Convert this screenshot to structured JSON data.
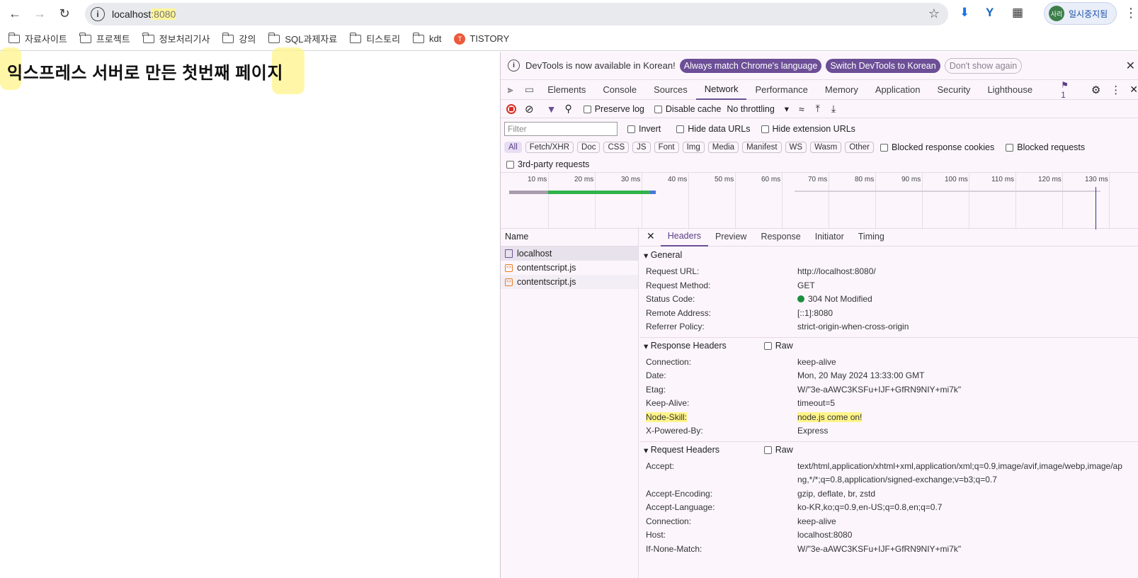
{
  "browser": {
    "url_host": "localhost",
    "url_port": ":8080",
    "profile_initials": "사리",
    "profile_label": "일시중지됨"
  },
  "bookmarks": [
    {
      "label": "자료사이트",
      "icon": "folder-icon"
    },
    {
      "label": "프로젝트",
      "icon": "folder-icon"
    },
    {
      "label": "정보처리기사",
      "icon": "folder-icon"
    },
    {
      "label": "강의",
      "icon": "folder-icon"
    },
    {
      "label": "SQL과제자료",
      "icon": "folder-icon"
    },
    {
      "label": "티스토리",
      "icon": "folder-icon"
    },
    {
      "label": "kdt",
      "icon": "folder-icon"
    },
    {
      "label": "TISTORY",
      "icon": "tistory-icon",
      "logo_text": "T"
    }
  ],
  "page": {
    "heading": "익스프레스 서버로 만든 첫번째 페이지"
  },
  "devtools": {
    "infobar": {
      "message": "DevTools is now available in Korean!",
      "btn_match": "Always match Chrome's language",
      "btn_switch": "Switch DevTools to Korean",
      "btn_dismiss": "Don't show again"
    },
    "tabs": [
      "Elements",
      "Console",
      "Sources",
      "Network",
      "Performance",
      "Memory",
      "Application",
      "Security",
      "Lighthouse"
    ],
    "issues_count": "1",
    "toolbar": {
      "preserve_log": "Preserve log",
      "disable_cache": "Disable cache",
      "throttling": "No throttling"
    },
    "filter": {
      "placeholder": "Filter",
      "invert": "Invert",
      "hide_data_urls": "Hide data URLs",
      "hide_ext_urls": "Hide extension URLs",
      "chips": [
        "All",
        "Fetch/XHR",
        "Doc",
        "CSS",
        "JS",
        "Font",
        "Img",
        "Media",
        "Manifest",
        "WS",
        "Wasm",
        "Other"
      ],
      "blocked_cookies": "Blocked response cookies",
      "blocked_requests": "Blocked requests",
      "third_party": "3rd-party requests"
    },
    "timeline_ticks": [
      "10 ms",
      "20 ms",
      "30 ms",
      "40 ms",
      "50 ms",
      "60 ms",
      "70 ms",
      "80 ms",
      "90 ms",
      "100 ms",
      "110 ms",
      "120 ms",
      "130 ms"
    ],
    "name_header": "Name",
    "requests": [
      "localhost",
      "contentscript.js",
      "contentscript.js"
    ],
    "detail_tabs": [
      "Headers",
      "Preview",
      "Response",
      "Initiator",
      "Timing"
    ],
    "general": {
      "title": "General",
      "rows": [
        {
          "k": "Request URL:",
          "v": "http://localhost:8080/"
        },
        {
          "k": "Request Method:",
          "v": "GET"
        },
        {
          "k": "Status Code:",
          "v": "304 Not Modified"
        },
        {
          "k": "Remote Address:",
          "v": "[::1]:8080"
        },
        {
          "k": "Referrer Policy:",
          "v": "strict-origin-when-cross-origin"
        }
      ]
    },
    "response_headers": {
      "title": "Response Headers",
      "raw": "Raw",
      "rows": [
        {
          "k": "Connection:",
          "v": "keep-alive"
        },
        {
          "k": "Date:",
          "v": "Mon, 20 May 2024 13:33:00 GMT"
        },
        {
          "k": "Etag:",
          "v": "W/\"3e-aAWC3KSFu+IJF+GfRN9NIY+mi7k\""
        },
        {
          "k": "Keep-Alive:",
          "v": "timeout=5"
        },
        {
          "k": "Node-Skill:",
          "v": "node.js come on!"
        },
        {
          "k": "X-Powered-By:",
          "v": "Express"
        }
      ]
    },
    "request_headers": {
      "title": "Request Headers",
      "raw": "Raw",
      "rows": [
        {
          "k": "Accept:",
          "v": "text/html,application/xhtml+xml,application/xml;q=0.9,image/avif,image/webp,image/apng,*/*;q=0.8,application/signed-exchange;v=b3;q=0.7"
        },
        {
          "k": "Accept-Encoding:",
          "v": "gzip, deflate, br, zstd"
        },
        {
          "k": "Accept-Language:",
          "v": "ko-KR,ko;q=0.9,en-US;q=0.8,en;q=0.7"
        },
        {
          "k": "Connection:",
          "v": "keep-alive"
        },
        {
          "k": "Host:",
          "v": "localhost:8080"
        },
        {
          "k": "If-None-Match:",
          "v": "W/\"3e-aAWC3KSFu+IJF+GfRN9NIY+mi7k\""
        }
      ]
    }
  }
}
